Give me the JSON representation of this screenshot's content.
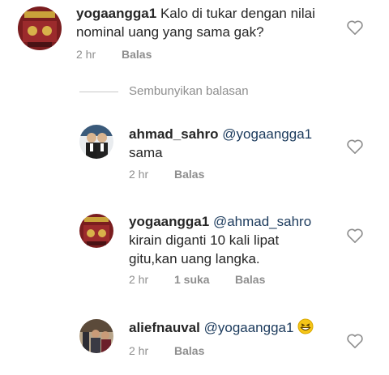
{
  "comment": {
    "username": "yogaangga1",
    "text_line1": "Kalo di tukar dengan nilai",
    "text_line2": "nominal uang yang sama gak?",
    "time": "2 hr",
    "reply_label": "Balas"
  },
  "hide_replies_label": "Sembunyikan balasan",
  "replies": [
    {
      "username": "ahmad_sahro",
      "mention": "@yogaangga1",
      "text_line1": "sama",
      "time": "2 hr",
      "reply_label": "Balas"
    },
    {
      "username": "yogaangga1",
      "mention": "@ahmad_sahro",
      "text_line1": "kirain diganti 10 kali lipat",
      "text_line2": "gitu,kan uang langka.",
      "time": "2 hr",
      "likes_label": "1 suka",
      "reply_label": "Balas"
    },
    {
      "username": "aliefnauval",
      "mention": "@yogaangga1",
      "emoji": "grinning-squinting-face",
      "time": "2 hr",
      "reply_label": "Balas"
    }
  ],
  "colors": {
    "text": "#262626",
    "muted": "#8e8e8e",
    "mention": "#1b3a5c",
    "divider": "#c7c7c7"
  },
  "icons": [
    "heart-outline-icon",
    "avatar-image",
    "emoji-grin-icon"
  ]
}
